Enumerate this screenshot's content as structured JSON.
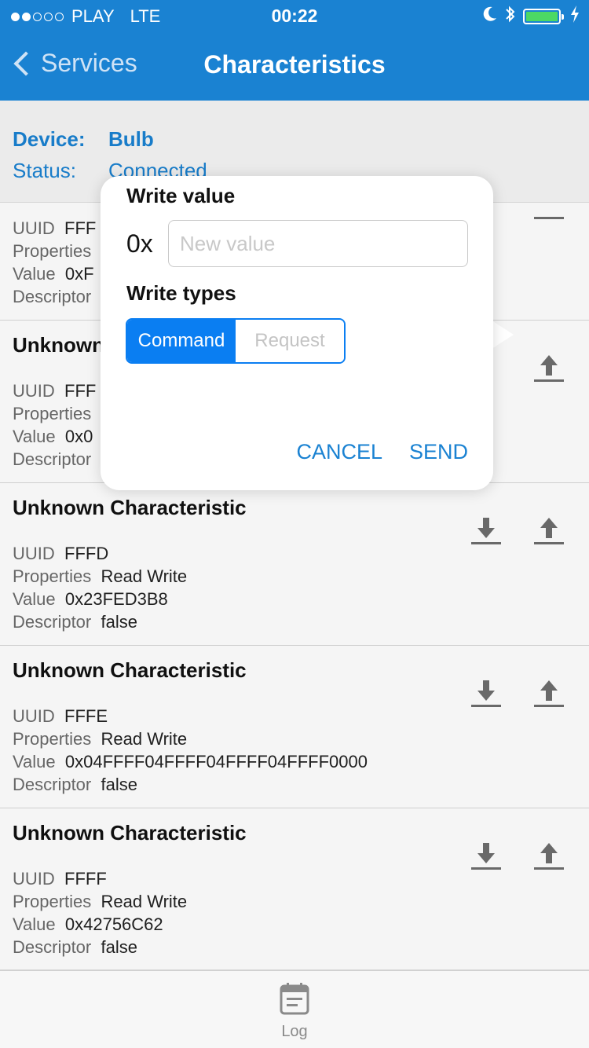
{
  "status_bar": {
    "carrier": "PLAY",
    "network": "LTE",
    "time": "00:22",
    "signal_bars": 2,
    "icons": [
      "moon-icon",
      "bluetooth-icon",
      "battery-icon",
      "charging-icon"
    ],
    "battery_level": 1.0
  },
  "nav": {
    "back_label": "Services",
    "title": "Characteristics"
  },
  "device": {
    "device_label": "Device:",
    "device_value": "Bulb",
    "status_label": "Status:",
    "status_value": "Connected"
  },
  "labels": {
    "uuid": "UUID",
    "properties": "Properties",
    "value": "Value",
    "descriptor": "Descriptor"
  },
  "characteristics": [
    {
      "title": "",
      "uuid": "FFF",
      "properties": "",
      "value": "0xF",
      "descriptor": ""
    },
    {
      "title": "Unknown",
      "uuid": "FFF",
      "properties": "",
      "value": "0x0",
      "descriptor": ""
    },
    {
      "title": "Unknown Characteristic",
      "uuid": "FFFD",
      "properties": "Read Write",
      "value": "0x23FED3B8",
      "descriptor": "false"
    },
    {
      "title": "Unknown Characteristic",
      "uuid": "FFFE",
      "properties": "Read Write",
      "value": "0x04FFFF04FFFF04FFFF04FFFF0000",
      "descriptor": "false"
    },
    {
      "title": "Unknown Characteristic",
      "uuid": "FFFF",
      "properties": "Read Write",
      "value": "0x42756C62",
      "descriptor": "false"
    }
  ],
  "dialog": {
    "title": "Write value",
    "prefix": "0x",
    "input_value": "",
    "input_placeholder": "New value",
    "types_title": "Write types",
    "types": [
      "Command",
      "Request"
    ],
    "selected_type": "Command",
    "cancel_label": "CANCEL",
    "send_label": "SEND"
  },
  "tabbar": {
    "log_label": "Log"
  },
  "colors": {
    "header": "#1a82d2",
    "accent": "#0a7ef2",
    "battery": "#4cd964"
  }
}
